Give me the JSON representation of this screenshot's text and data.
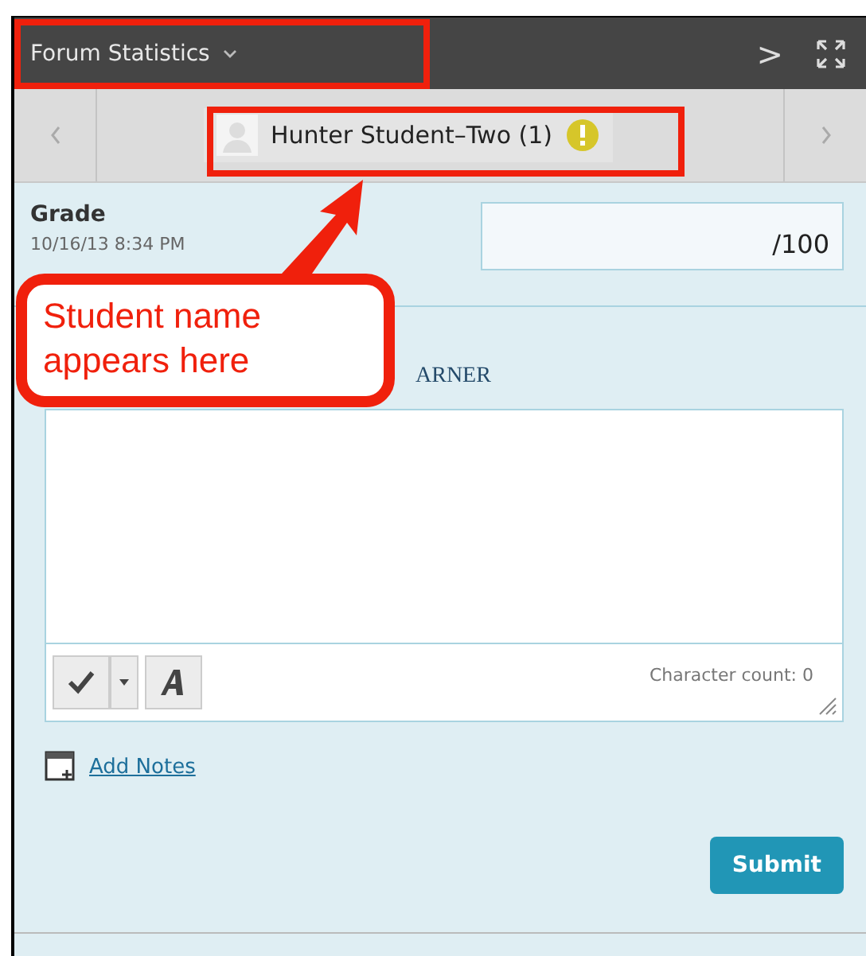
{
  "header": {
    "title": "Forum Statistics",
    "next": ">"
  },
  "student_nav": {
    "name": "Hunter Student–Two (1)"
  },
  "grade": {
    "label": "Grade",
    "timestamp": "10/16/13 8:34 PM",
    "suffix": "/100"
  },
  "feedback": {
    "label": "ARNER",
    "character_count": "Character count: 0"
  },
  "add_notes": "Add Notes",
  "submit": "Submit",
  "callout": {
    "text": "Student name appears here"
  }
}
